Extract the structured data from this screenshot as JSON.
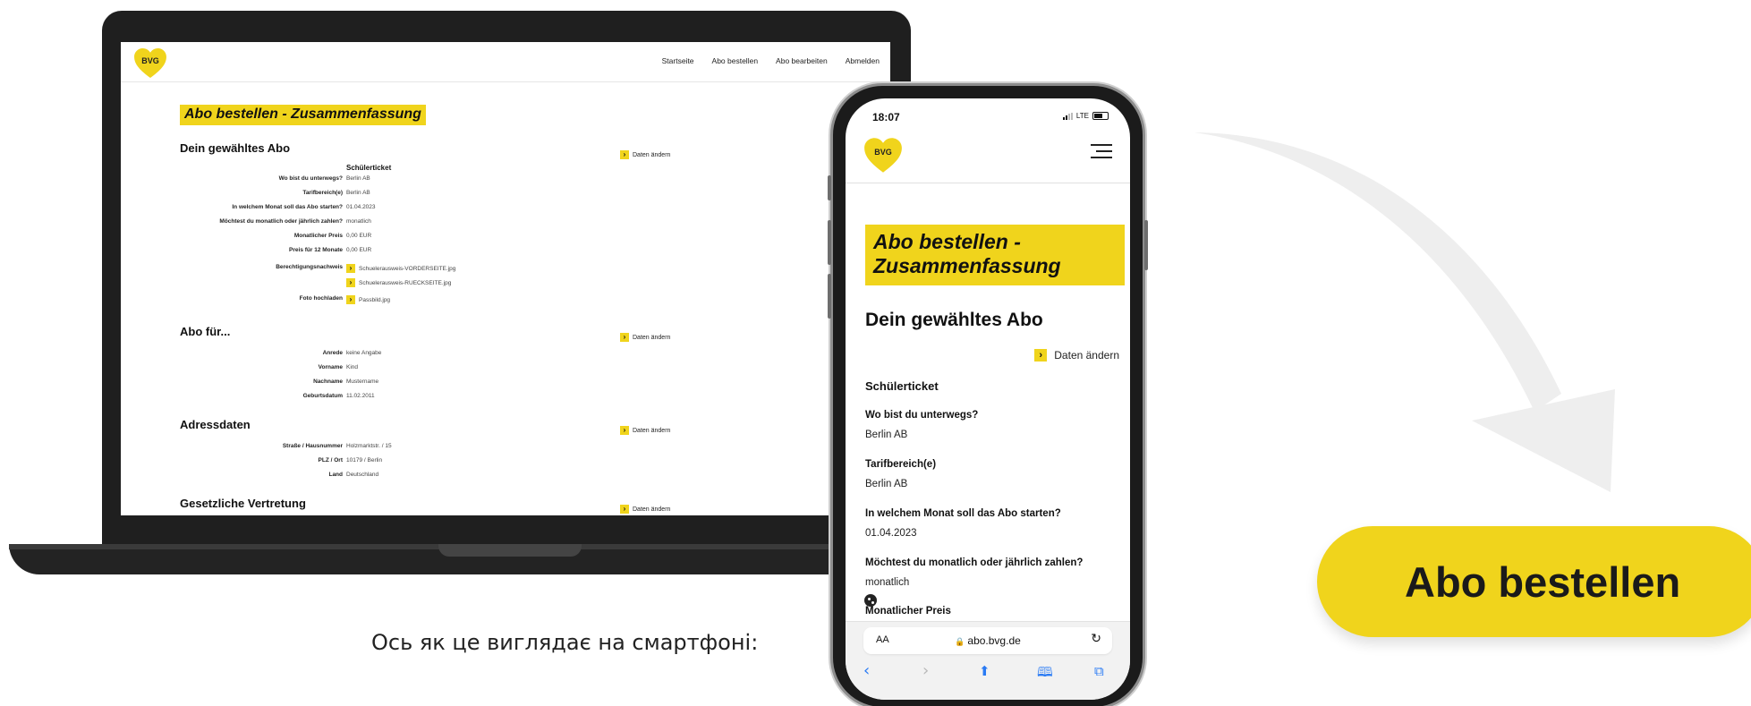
{
  "brand": {
    "logo_text": "BVG",
    "accent_color": "#f0d41c",
    "logo_color": "#f0d41c"
  },
  "desktop": {
    "nav": [
      "Startseite",
      "Abo bestellen",
      "Abo bearbeiten",
      "Abmelden"
    ],
    "page_title": "Abo bestellen - Zusammenfassung",
    "change_label": "Daten ändern",
    "sections": {
      "abo": {
        "title": "Dein gewähltes Abo",
        "ticket": "Schülerticket",
        "rows": [
          {
            "label": "Wo bist du unterwegs?",
            "value": "Berlin AB"
          },
          {
            "label": "Tarifbereich(e)",
            "value": "Berlin AB"
          },
          {
            "label": "In welchem Monat soll das Abo starten?",
            "value": "01.04.2023"
          },
          {
            "label": "Möchtest du monatlich oder jährlich zahlen?",
            "value": "monatlich"
          },
          {
            "label": "Monatlicher Preis",
            "value": "0,00 EUR"
          },
          {
            "label": "Preis für 12 Monate",
            "value": "0,00 EUR"
          },
          {
            "label": "Berechtigungsnachweis",
            "value": "Schuelerausweis-VORDERSEITE.jpg"
          },
          {
            "label": "",
            "value": "Schuelerausweis-RUECKSEITE.jpg"
          },
          {
            "label": "Foto hochladen",
            "value": "Passbild.jpg"
          }
        ]
      },
      "person": {
        "title": "Abo für...",
        "rows": [
          {
            "label": "Anrede",
            "value": "keine Angabe"
          },
          {
            "label": "Vorname",
            "value": "Kind"
          },
          {
            "label": "Nachname",
            "value": "Mustername"
          },
          {
            "label": "Geburtsdatum",
            "value": "11.02.2011"
          }
        ]
      },
      "address": {
        "title": "Adressdaten",
        "rows": [
          {
            "label": "Straße / Hausnummer",
            "value": "Holzmarktstr. / 15"
          },
          {
            "label": "PLZ / Ort",
            "value": "10179 / Berlin"
          },
          {
            "label": "Land",
            "value": "Deutschland"
          }
        ]
      },
      "guardian": {
        "title": "Gesetzliche Vertretung"
      }
    }
  },
  "mobile": {
    "time": "18:07",
    "network": "LTE",
    "page_title": "Abo bestellen - Zusammenfassung",
    "section_title": "Dein gewähltes Abo",
    "change_label": "Daten ändern",
    "ticket": "Schülerticket",
    "fields": [
      {
        "label": "Wo bist du unterwegs?",
        "value": "Berlin AB"
      },
      {
        "label": "Tarifbereich(e)",
        "value": "Berlin AB"
      },
      {
        "label": "In welchem Monat soll das Abo starten?",
        "value": "01.04.2023"
      },
      {
        "label": "Möchtest du monatlich oder jährlich zahlen?",
        "value": "monatlich"
      }
    ],
    "partial_label": "Monatlicher Preis",
    "browser": {
      "text_size": "AA",
      "url": "abo.bvg.de"
    }
  },
  "caption": "Ось як це виглядає на смартфоні:",
  "cta": {
    "label": "Abo bestellen"
  },
  "icons": [
    "bvg-heart-logo-icon",
    "chevron-right-icon",
    "hamburger-menu-icon",
    "cookie-icon",
    "lock-icon",
    "reload-icon",
    "back-icon",
    "forward-icon",
    "share-icon",
    "bookmarks-icon",
    "tabs-icon",
    "curved-arrow-icon"
  ]
}
